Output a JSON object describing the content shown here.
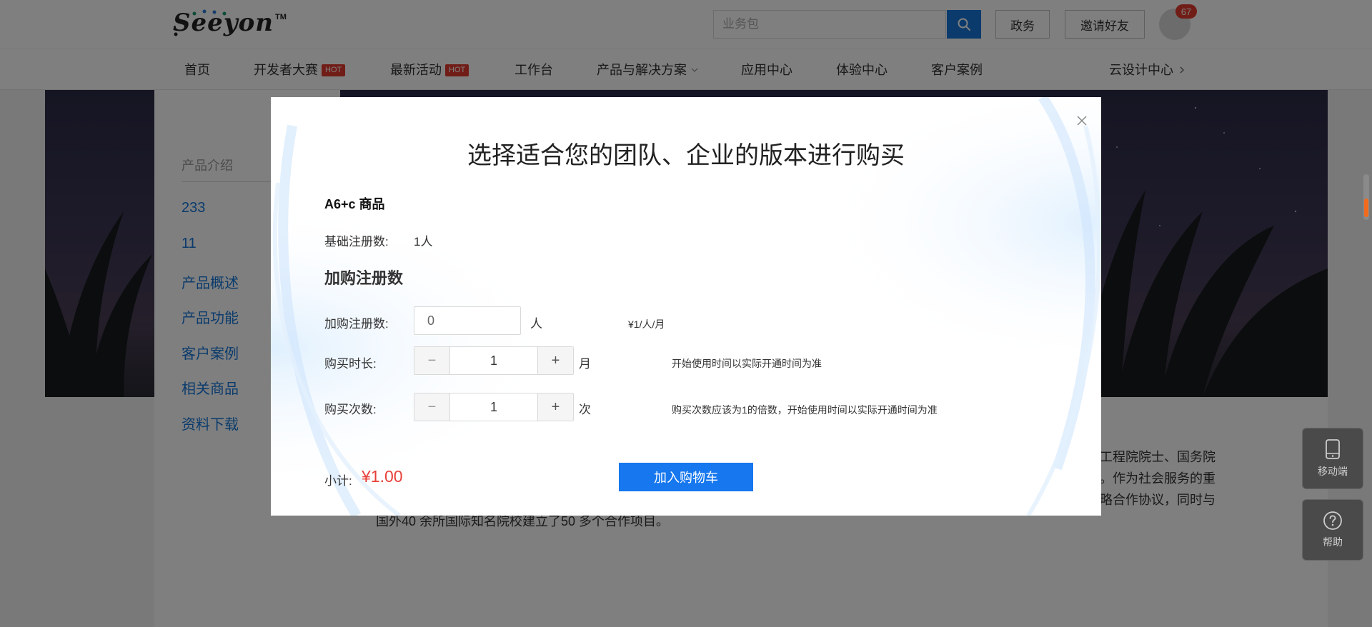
{
  "header": {
    "logo_text": "Seeyon",
    "logo_tm": "TM",
    "search_placeholder": "业务包",
    "btn_government": "政务",
    "btn_invite": "邀请好友",
    "notification_count": "67"
  },
  "nav": {
    "items": [
      {
        "label": "首页",
        "hot": ""
      },
      {
        "label": "开发者大赛",
        "hot": "HOT"
      },
      {
        "label": "最新活动",
        "hot": "HOT"
      },
      {
        "label": "工作台",
        "hot": ""
      },
      {
        "label": "产品与解决方案",
        "hot": ""
      },
      {
        "label": "应用中心",
        "hot": ""
      },
      {
        "label": "体验中心",
        "hot": ""
      },
      {
        "label": "客户案例",
        "hot": ""
      }
    ],
    "right_link": "云设计中心"
  },
  "sidebar": {
    "title": "产品介绍",
    "items": [
      "233",
      "11",
      "产品概述",
      "产品功能",
      "客户案例",
      "相关商品",
      "资料下载"
    ]
  },
  "background_content": {
    "line1_end": "工程院院士、国务院",
    "line2_end": "。作为社会服务的重",
    "line3_end": "略合作协议，同时与",
    "line4": "国外40 余所国际知名院校建立了50 多个合作项目。"
  },
  "float_buttons": {
    "mobile": "移动端",
    "help": "帮助"
  },
  "modal": {
    "title": "选择适合您的团队、企业的版本进行购买",
    "product_name": "A6+c 商品",
    "base_reg_label": "基础注册数:",
    "base_reg_value": "1人",
    "section_title": "加购注册数",
    "add_reg_label": "加购注册数:",
    "add_reg_value": "0",
    "add_reg_unit": "人",
    "price_note": "¥1/人/月",
    "duration_label": "购买时长:",
    "duration_value": "1",
    "duration_unit": "月",
    "duration_note": "开始使用时间以实际开通时间为准",
    "times_label": "购买次数:",
    "times_value": "1",
    "times_unit": "次",
    "times_note": "购买次数应该为1的倍数，开始使用时间以实际开通时间为准",
    "subtotal_label": "小计:",
    "subtotal_value": "¥1.00",
    "add_cart_label": "加入购物车",
    "minus_symbol": "−",
    "plus_symbol": "+"
  },
  "colors": {
    "primary_blue": "#1677ee",
    "hot_red": "#e23a2e",
    "price_red": "#e8413a"
  }
}
